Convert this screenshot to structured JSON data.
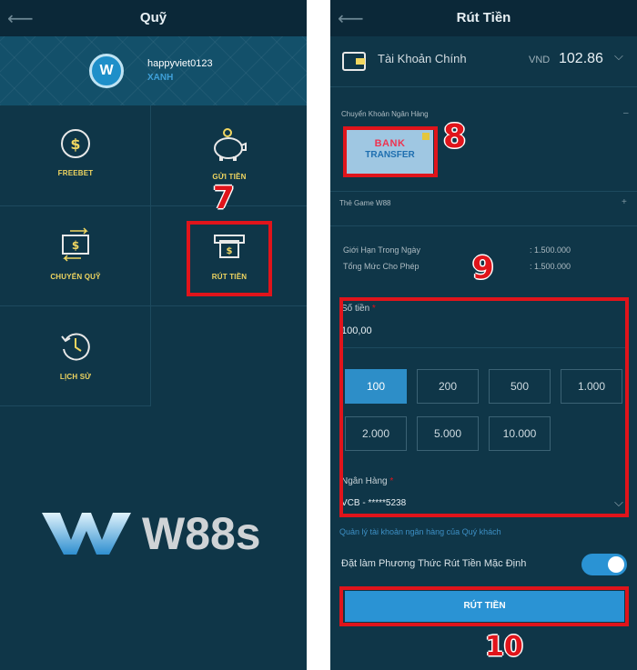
{
  "left": {
    "title": "Quỹ",
    "user": {
      "avatar_letter": "W",
      "username": "happyviet0123",
      "level": "XANH"
    },
    "tiles": [
      {
        "label": "FREEBET"
      },
      {
        "label": "GỬI TIỀN"
      },
      {
        "label": "CHUYỂN QUỸ"
      },
      {
        "label": "RÚT TIỀN"
      },
      {
        "label": "LỊCH SỬ"
      }
    ],
    "step_number": "7",
    "brand": "W88s"
  },
  "right": {
    "title": "Rút Tiền",
    "account": {
      "name": "Tài Khoản Chính",
      "currency": "VND",
      "balance": "102.86"
    },
    "section_bank": "Chuyển Khoản Ngân Hàng",
    "bank_card": {
      "line1": "BANK",
      "line2": "TRANSFER"
    },
    "step_8": "8",
    "section_game": "Thẻ Game W88",
    "limits": [
      {
        "label": "Giới Hạn Trong Ngày",
        "value": ": 1.500.000"
      },
      {
        "label": "Tổng Mức Cho Phép",
        "value": ": 1.500.000"
      }
    ],
    "step_9": "9",
    "amount_label": "Số tiền",
    "amount_value": "100,00",
    "amount_options": [
      "100",
      "200",
      "500",
      "1.000",
      "2.000",
      "5.000",
      "10.000"
    ],
    "selected_amount": "100",
    "bank_label": "Ngân Hàng",
    "bank_value": "VCB - *****5238",
    "manage_link": "Quản lý tài khoản ngân hàng của Quý khách",
    "default_toggle_label": "Đặt làm Phương Thức Rút Tiền Mặc Định",
    "default_toggle_on": true,
    "submit_label": "RÚT TIỀN",
    "step_10": "10"
  },
  "colors": {
    "panel_bg": "#0f3648",
    "header_bg": "#0b2838",
    "accent": "#2a93d4",
    "icon_gold": "#f0d660",
    "highlight_red": "#e0141b"
  }
}
